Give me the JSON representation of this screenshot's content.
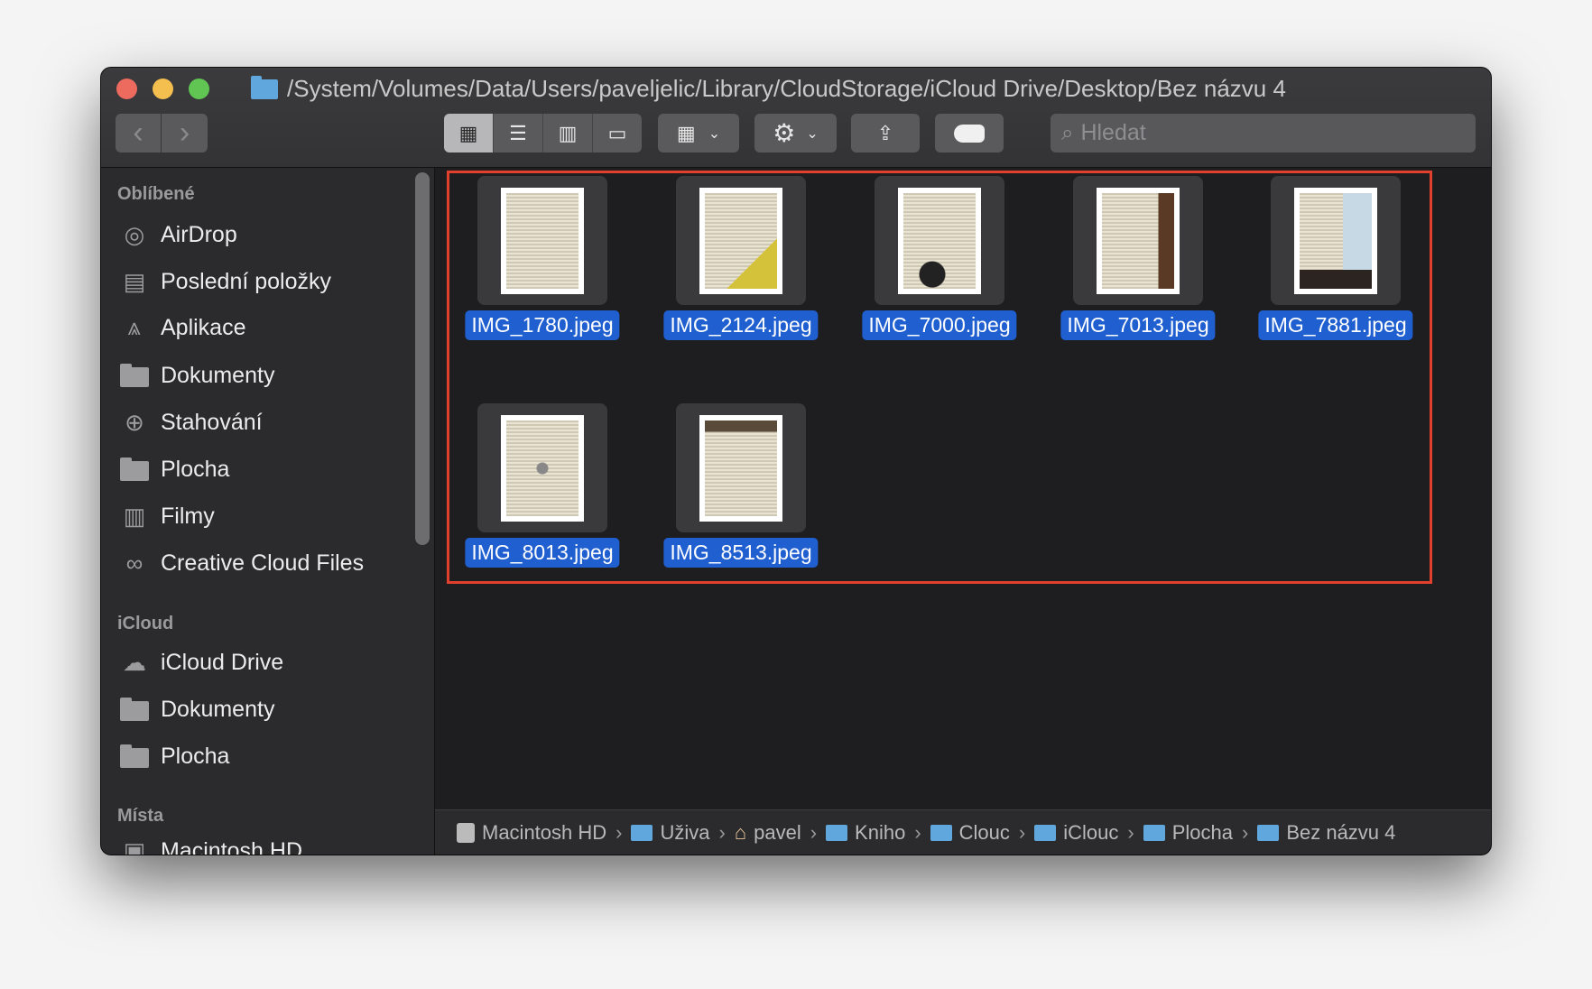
{
  "window": {
    "title": "/System/Volumes/Data/Users/paveljelic/Library/CloudStorage/iCloud Drive/Desktop/Bez názvu 4"
  },
  "toolbar": {
    "back": "‹",
    "forward": "›",
    "search_placeholder": "Hledat"
  },
  "sidebar": {
    "sections": [
      {
        "title": "Oblíbené",
        "items": [
          {
            "label": "AirDrop",
            "icon": "airdrop-icon"
          },
          {
            "label": "Poslední položky",
            "icon": "recents-icon"
          },
          {
            "label": "Aplikace",
            "icon": "applications-icon"
          },
          {
            "label": "Dokumenty",
            "icon": "folder-icon"
          },
          {
            "label": "Stahování",
            "icon": "downloads-icon"
          },
          {
            "label": "Plocha",
            "icon": "folder-icon"
          },
          {
            "label": "Filmy",
            "icon": "movies-icon"
          },
          {
            "label": "Creative Cloud Files",
            "icon": "creative-cloud-icon"
          }
        ]
      },
      {
        "title": "iCloud",
        "items": [
          {
            "label": "iCloud Drive",
            "icon": "cloud-icon"
          },
          {
            "label": "Dokumenty",
            "icon": "folder-icon"
          },
          {
            "label": "Plocha",
            "icon": "folder-icon"
          }
        ]
      },
      {
        "title": "Místa",
        "items": [
          {
            "label": "Macintosh HD",
            "icon": "disk-icon"
          }
        ]
      }
    ]
  },
  "files": [
    {
      "name": "IMG_1780.jpeg"
    },
    {
      "name": "IMG_2124.jpeg"
    },
    {
      "name": "IMG_7000.jpeg"
    },
    {
      "name": "IMG_7013.jpeg"
    },
    {
      "name": "IMG_7881.jpeg"
    },
    {
      "name": "IMG_8013.jpeg"
    },
    {
      "name": "IMG_8513.jpeg"
    }
  ],
  "pathbar": [
    "Macintosh HD",
    "Uživa",
    "pavel",
    "Kniho",
    "Clouc",
    "iClouc",
    "Plocha",
    "Bez názvu 4"
  ],
  "colors": {
    "selection": "#1f5fd0",
    "highlight_box": "#e0402c"
  }
}
